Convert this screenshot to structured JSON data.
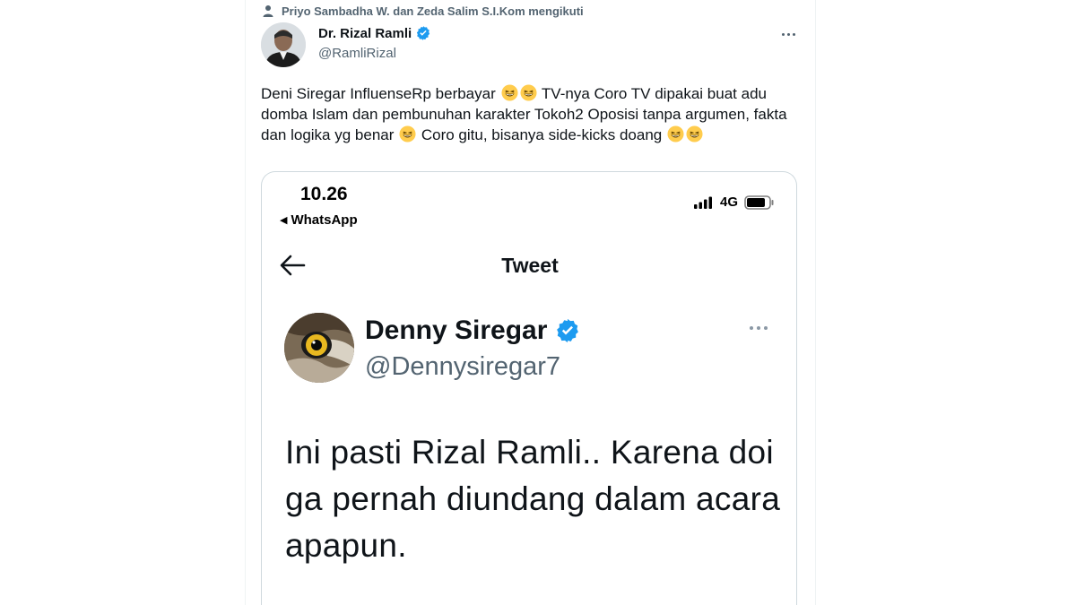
{
  "social_context": {
    "text": "Priyo Sambadha W. dan Zeda Salim S.I.Kom mengikuti",
    "icon": "person-icon"
  },
  "tweet": {
    "author_name": "Dr. Rizal Ramli",
    "author_handle": "@RamliRizal",
    "verified_color": "#1d9bf0",
    "text_parts": {
      "p1": "Deni Siregar InfluenseRp berbayar",
      "p2": "TV-nya Coro TV dipakai buat adu domba Islam dan pembunuhan karakter Tokoh2 Oposisi tanpa argumen, fakta dan logika yg benar",
      "p3": "Coro gitu, bisanya side-kicks doang"
    },
    "emoji": "grinning-squinting-face"
  },
  "screenshot": {
    "status_time": "10.26",
    "status_back": "WhatsApp",
    "network": "4G",
    "nav_title": "Tweet",
    "inner_author_name": "Denny Siregar",
    "inner_author_handle": "@Dennysiregar7",
    "inner_text": "Ini pasti Rizal Ramli.. Karena doi ga pernah diundang dalam acara apapun."
  },
  "colors": {
    "accent": "#1d9bf0",
    "secondary_text": "#536471",
    "border": "#cfd9de"
  }
}
